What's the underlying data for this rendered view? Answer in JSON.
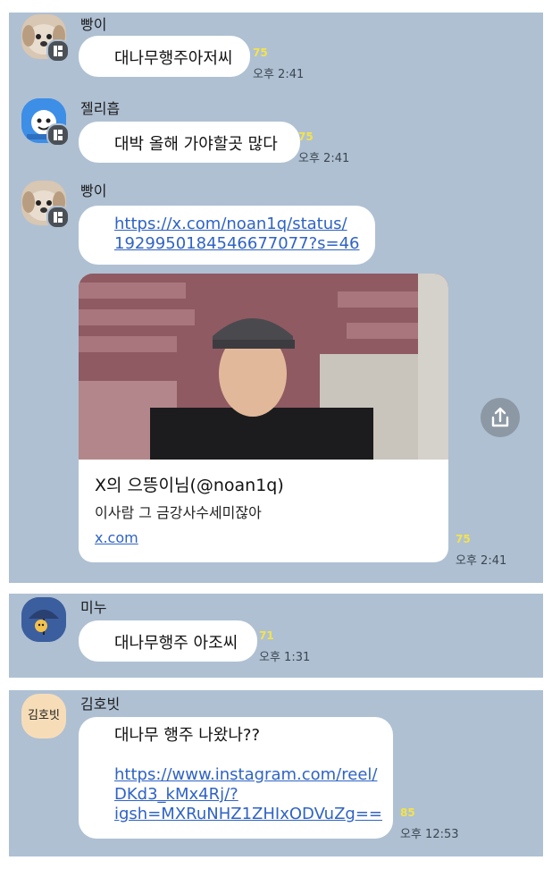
{
  "messages": {
    "m1": {
      "sender": "빵이",
      "text": "대나무행주아저씨",
      "unread": "75",
      "time": "오후 2:41"
    },
    "m2": {
      "sender": "젤리흡",
      "text": "대박 올해 가야할곳 많다",
      "unread": "75",
      "time": "오후 2:41"
    },
    "m3": {
      "sender": "빵이",
      "link_line1": "https://x.com/noan1q/status/",
      "link_line2": "1929950184546677077?s=46",
      "preview": {
        "title": "X의 으뜽이님(@noan1q)",
        "description": "이사람 그 금강사수세미잖아",
        "domain": "x.com"
      },
      "unread": "75",
      "time": "오후 2:41"
    },
    "m4": {
      "sender": "미누",
      "text": "대나무행주 아조씨",
      "unread": "71",
      "time": "오후 1:31"
    },
    "m5": {
      "sender": "김호빗",
      "avatar_label": "김호빗",
      "text": "대나무 행주 나왔나??",
      "link_line1": "https://www.instagram.com/reel/",
      "link_line2": "DKd3_kMx4Rj/?",
      "link_line3": "igsh=MXRuNHZ1ZHIxODVuZg==",
      "unread": "85",
      "time": "오후 12:53"
    }
  },
  "colors": {
    "chat_background": "#afc0d3",
    "bubble": "#ffffff",
    "link": "#2f63c5",
    "unread_count": "#f4e34a"
  },
  "icons": {
    "badge": "chat-badge-icon",
    "share": "share-icon"
  }
}
